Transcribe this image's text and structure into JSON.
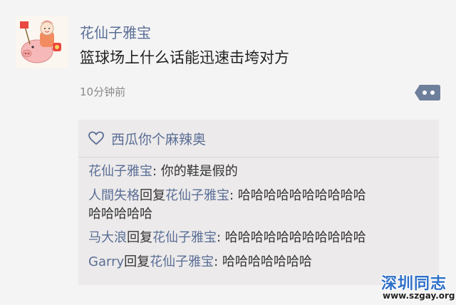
{
  "post": {
    "author": "花仙子雅宝",
    "content": "篮球场上什么话能迅速击垮对方",
    "time": "10分钟前"
  },
  "likes": {
    "icon": "heart-icon",
    "names": "西瓜你个麻辣奥"
  },
  "comments": [
    {
      "author": "花仙子雅宝",
      "sep": ": ",
      "text": "你的鞋是假的"
    },
    {
      "author": "人間失格",
      "reply_word": "回复",
      "target": "花仙子雅宝",
      "sep": ": ",
      "text": "哈哈哈哈哈哈哈哈哈哈",
      "text2": "哈哈哈哈哈"
    },
    {
      "author": "马大浪",
      "reply_word": "回复",
      "target": "花仙子雅宝",
      "sep": ": ",
      "text": "哈哈哈哈哈哈哈哈哈哈哈"
    },
    {
      "author": "Garry",
      "reply_word": "回复",
      "target": "花仙子雅宝",
      "sep": ": ",
      "text": "哈哈哈哈哈哈哈"
    }
  ],
  "watermark": {
    "title": "深圳同志",
    "url": "www.szgay.org"
  },
  "colors": {
    "name_blue": "#5a6e96",
    "box_bg": "#eceaea"
  }
}
